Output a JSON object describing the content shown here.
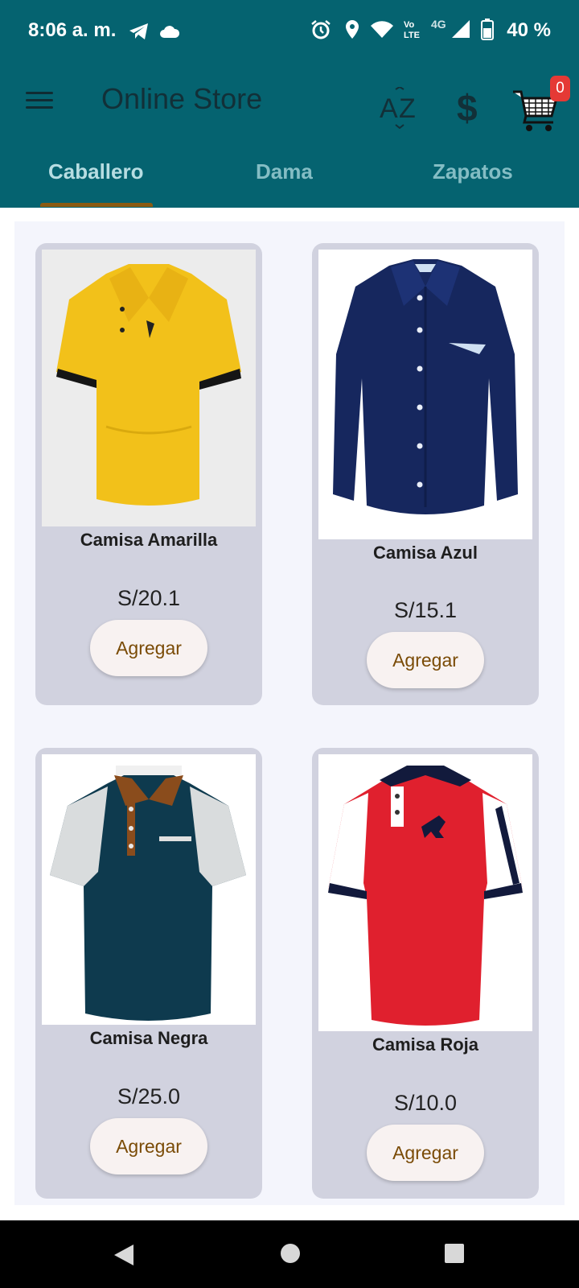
{
  "status_bar": {
    "time": "8:06 a. m.",
    "battery_text": "40 %",
    "network_label": "4G"
  },
  "toolbar": {
    "title": "Online Store",
    "cart_count": "0"
  },
  "tabs": [
    {
      "label": "Caballero",
      "active": true
    },
    {
      "label": "Dama",
      "active": false
    },
    {
      "label": "Zapatos",
      "active": false
    }
  ],
  "products": [
    {
      "name": "Camisa Amarilla",
      "price": "S/20.1",
      "button": "Agregar",
      "color": "#f2c11a"
    },
    {
      "name": "Camisa Azul",
      "price": "S/15.1",
      "button": "Agregar",
      "color": "#16275e"
    },
    {
      "name": "Camisa Negra",
      "price": "S/25.0",
      "button": "Agregar",
      "color": "#0e3a4e"
    },
    {
      "name": "Camisa Roja",
      "price": "S/10.0",
      "button": "Agregar",
      "color": "#e0202e"
    }
  ],
  "colors": {
    "appbar": "#056370",
    "accent": "#8a5a12",
    "badge": "#e53935"
  }
}
